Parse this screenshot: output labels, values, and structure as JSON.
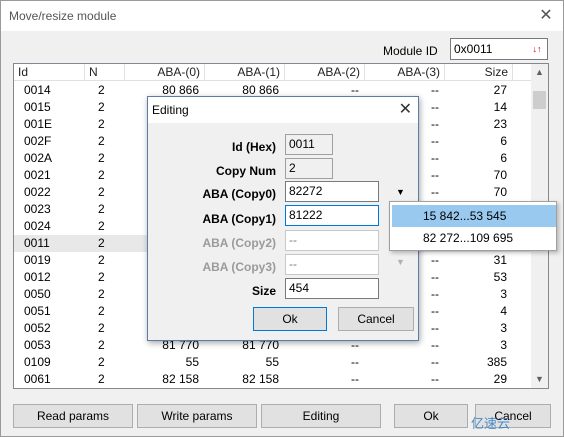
{
  "window": {
    "title": "Move/resize module",
    "close": "✕"
  },
  "module": {
    "label": "Module ID",
    "value": "0x0011"
  },
  "table": {
    "columns": [
      "Id",
      "N",
      "ABA-(0)",
      "ABA-(1)",
      "ABA-(2)",
      "ABA-(3)",
      "Size"
    ],
    "rows": [
      [
        "0014",
        "2",
        "80 866",
        "80 866",
        "--",
        "--",
        "27"
      ],
      [
        "0015",
        "2",
        "",
        "",
        "",
        "--",
        "14"
      ],
      [
        "001E",
        "2",
        "",
        "",
        "",
        "--",
        "23"
      ],
      [
        "002F",
        "2",
        "",
        "",
        "",
        "--",
        "6"
      ],
      [
        "002A",
        "2",
        "",
        "",
        "",
        "--",
        "6"
      ],
      [
        "0021",
        "2",
        "",
        "",
        "",
        "--",
        "70"
      ],
      [
        "0022",
        "2",
        "",
        "",
        "",
        "--",
        "70"
      ],
      [
        "0023",
        "2",
        "",
        "",
        "",
        "",
        ""
      ],
      [
        "0024",
        "2",
        "",
        "",
        "",
        "",
        ""
      ],
      [
        "0011",
        "2",
        "",
        "",
        "",
        "",
        ""
      ],
      [
        "0019",
        "2",
        "",
        "",
        "",
        "--",
        "31"
      ],
      [
        "0012",
        "2",
        "",
        "",
        "",
        "--",
        "53"
      ],
      [
        "0050",
        "2",
        "",
        "",
        "",
        "--",
        "3"
      ],
      [
        "0051",
        "2",
        "",
        "",
        "",
        "--",
        "4"
      ],
      [
        "0052",
        "2",
        "",
        "",
        "",
        "--",
        "3"
      ],
      [
        "0053",
        "2",
        "81 770",
        "81 770",
        "--",
        "--",
        "3"
      ],
      [
        "0109",
        "2",
        "55",
        "55",
        "--",
        "--",
        "385"
      ],
      [
        "0061",
        "2",
        "82 158",
        "82 158",
        "--",
        "--",
        "29"
      ]
    ],
    "selected_row": 9
  },
  "buttons": {
    "read": "Read params",
    "write": "Write params",
    "editing": "Editing",
    "ok": "Ok",
    "cancel": "Cancel"
  },
  "dialog": {
    "title": "Editing",
    "fields": [
      {
        "label": "Id (Hex)",
        "value": "0011"
      },
      {
        "label": "Copy Num",
        "value": "2"
      },
      {
        "label": "ABA (Copy0)",
        "value": "82272"
      },
      {
        "label": "ABA (Copy1)",
        "value": "81222"
      },
      {
        "label": "ABA (Copy2)",
        "value": "--"
      },
      {
        "label": "ABA (Copy3)",
        "value": "--"
      },
      {
        "label": "Size",
        "value": "454"
      }
    ],
    "ok": "Ok",
    "cancel": "Cancel"
  },
  "dropdown": {
    "items": [
      "15 842...53 545",
      "82 272...109 695"
    ],
    "highlighted": 0
  },
  "watermark": "亿速云",
  "colors": {
    "highlight": "#99c9ef",
    "accent_red": "#c00000",
    "dialog_border": "#5b7ba8"
  }
}
